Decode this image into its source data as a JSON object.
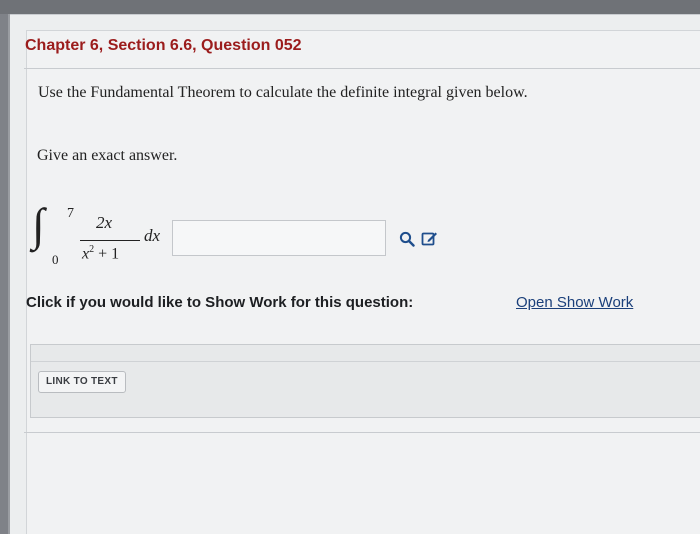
{
  "question": {
    "chapter_title": "Chapter 6, Section 6.6, Question 052",
    "instruction": "Use the Fundamental Theorem to calculate the definite integral given below.",
    "exact_note": "Give an exact answer."
  },
  "integral": {
    "upper_limit": "7",
    "lower_limit": "0",
    "numerator": "2x",
    "denominator_var": "x",
    "denominator_exp": "2",
    "denominator_rest": " + 1",
    "differential": "dx"
  },
  "answer": {
    "value": "",
    "icons": [
      "search-icon",
      "edit-icon"
    ]
  },
  "show_work": {
    "prompt": "Click if you would like to Show Work for this question:",
    "link_label": "Open Show Work",
    "link_to_text_label": "LINK TO TEXT"
  },
  "colors": {
    "title_red": "#9b1c1c",
    "link_blue": "#1a3f7a",
    "icon_blue": "#1f4e8c"
  }
}
